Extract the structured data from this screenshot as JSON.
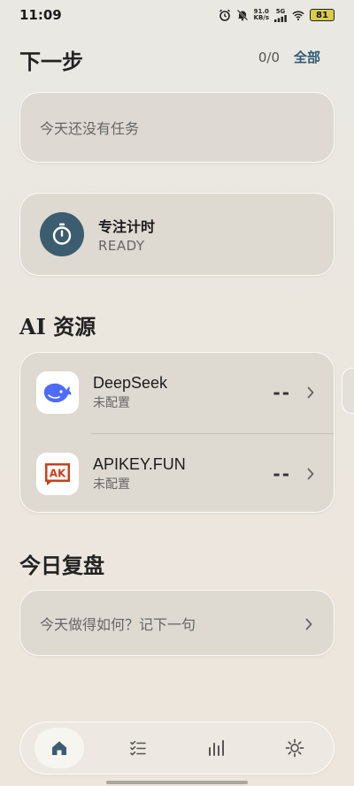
{
  "status_bar": {
    "time": "11:09",
    "net_speed": "91.0",
    "net_unit": "KB/s",
    "network": "5G",
    "battery": "81"
  },
  "next_step": {
    "title": "下一步",
    "count": "0/0",
    "all_label": "全部",
    "empty_text": "今天还没有任务"
  },
  "focus": {
    "title": "专注计时",
    "status": "READY",
    "icon": "stopwatch-icon"
  },
  "ai_resources": {
    "title": "AI 资源",
    "items": [
      {
        "name": "DeepSeek",
        "status": "未配置",
        "value": "--",
        "icon": "deepseek-whale-icon"
      },
      {
        "name": "APIKEY.FUN",
        "status": "未配置",
        "value": "--",
        "icon": "ak-badge-icon",
        "badge_text": "AK"
      }
    ]
  },
  "review": {
    "title": "今日复盘",
    "prompt": "今天做得如何？记下一句"
  },
  "nav": {
    "items": [
      {
        "icon": "home-icon",
        "active": true
      },
      {
        "icon": "task-list-icon",
        "active": false
      },
      {
        "icon": "bar-chart-icon",
        "active": false
      },
      {
        "icon": "settings-sun-icon",
        "active": false
      }
    ]
  },
  "colors": {
    "accent": "#2f5c74",
    "timer_bg": "#3b5d6f",
    "deepseek_blue": "#4d6bfe",
    "ak_red": "#c8401e"
  }
}
